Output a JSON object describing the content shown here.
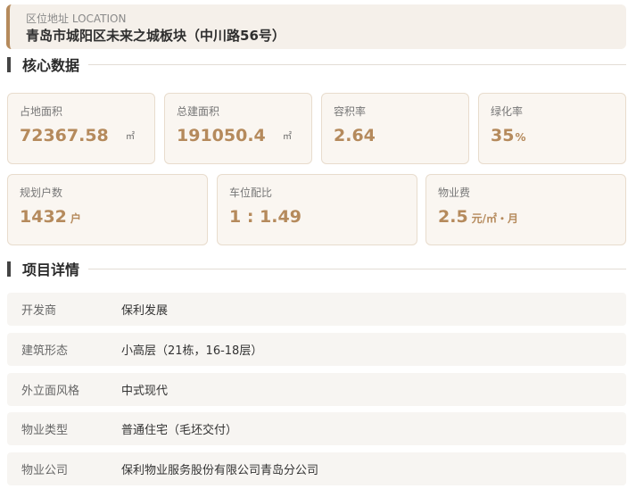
{
  "location": {
    "label": "区位地址 LOCATION",
    "value": "青岛市城阳区未来之城板块（中川路56号）"
  },
  "sections": {
    "core": "核心数据",
    "details": "项目详情"
  },
  "core_data": [
    {
      "label": "占地面积",
      "value": "72367.58",
      "unit": "㎡"
    },
    {
      "label": "总建面积",
      "value": "191050.4",
      "unit": "㎡"
    },
    {
      "label": "容积率",
      "value": "2.64",
      "unit": ""
    },
    {
      "label": "绿化率",
      "value": "35",
      "unit": "%"
    },
    {
      "label": "规划户数",
      "value": "1432",
      "unit": "户"
    },
    {
      "label": "车位配比",
      "value": "1 : 1.49",
      "unit": ""
    },
    {
      "label": "物业费",
      "value": "2.5",
      "unit": "元/㎡・月"
    }
  ],
  "details": [
    {
      "key": "开发商",
      "value": "保利发展"
    },
    {
      "key": "建筑形态",
      "value": "小高层（21栋，16-18层）"
    },
    {
      "key": "外立面风格",
      "value": "中式现代"
    },
    {
      "key": "物业类型",
      "value": "普通住宅（毛坯交付）"
    },
    {
      "key": "物业公司",
      "value": "保利物业服务股份有限公司青岛分公司"
    }
  ],
  "colors": {
    "accent": "#b58a5c",
    "card_bg": "#faf6f1",
    "row_bg": "#f7f5f2"
  }
}
